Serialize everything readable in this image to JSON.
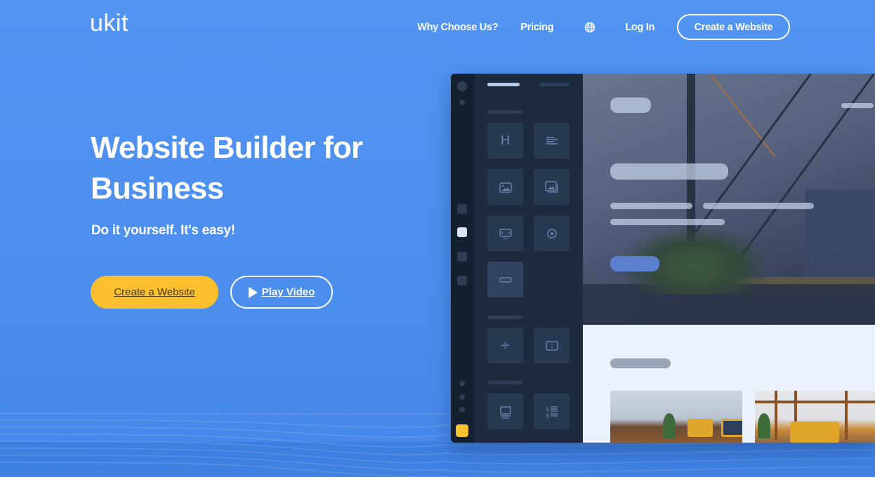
{
  "header": {
    "logo": "ukit",
    "nav": [
      {
        "label": "Why Choose Us?"
      },
      {
        "label": "Pricing"
      },
      {
        "icon": "globe-icon"
      },
      {
        "label": "Log In"
      }
    ],
    "cta_label": "Create a Website"
  },
  "hero": {
    "title": "Website Builder for Business",
    "subtitle": "Do it yourself. It's easy!",
    "primary_button": "Create a Website",
    "video_button": "Play Video"
  },
  "editor_mockup": {
    "widget_tiles": [
      {
        "icon": "heading-icon",
        "glyph": "H"
      },
      {
        "icon": "text-icon"
      },
      {
        "icon": "image-icon"
      },
      {
        "icon": "gallery-icon"
      },
      {
        "icon": "slider-icon"
      },
      {
        "icon": "radio-icon"
      },
      {
        "icon": "button-icon"
      },
      {
        "icon": "divider-icon",
        "glyph": "÷"
      },
      {
        "icon": "embed-icon"
      },
      {
        "icon": "monitor-icon"
      },
      {
        "icon": "price-list-icon"
      }
    ]
  },
  "colors": {
    "background": "#5294f2",
    "accent_yellow": "#fcc02e",
    "editor_dark": "#1e2b3f",
    "editor_rail": "#13202f"
  }
}
